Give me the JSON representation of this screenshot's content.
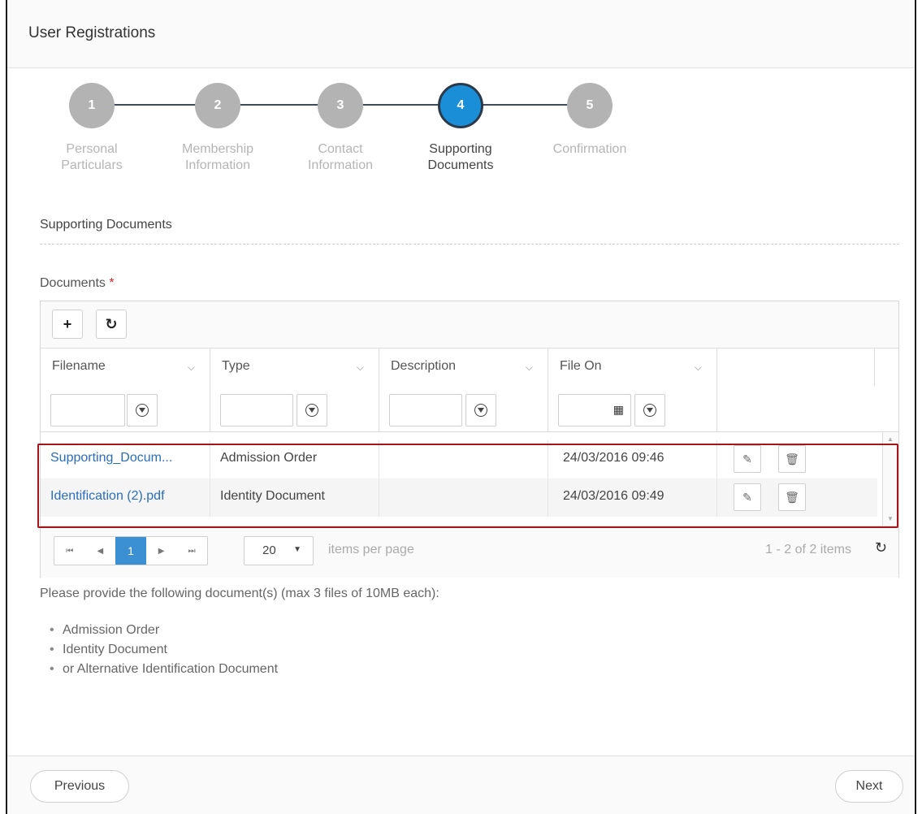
{
  "window": {
    "title": "User Registrations"
  },
  "stepper": {
    "steps": [
      {
        "number": "1",
        "label_line1": "Personal",
        "label_line2": "Particulars"
      },
      {
        "number": "2",
        "label_line1": "Membership",
        "label_line2": "Information"
      },
      {
        "number": "3",
        "label_line1": "Contact",
        "label_line2": "Information"
      },
      {
        "number": "4",
        "label_line1": "Supporting",
        "label_line2": "Documents"
      },
      {
        "number": "5",
        "label_line1": "Confirmation",
        "label_line2": ""
      }
    ],
    "active_step": 4
  },
  "section": {
    "title": "Supporting Documents"
  },
  "documents": {
    "label": "Documents",
    "required_mark": "*",
    "toolbar": {
      "add_icon": "plus-icon",
      "refresh_icon": "refresh-icon"
    },
    "columns": [
      "Filename",
      "Type",
      "Description",
      "File On"
    ],
    "rows": [
      {
        "filename": "Supporting_Docum...",
        "type": "Admission Order",
        "description": "",
        "file_on": "24/03/2016 09:46"
      },
      {
        "filename": "Identification (2).pdf",
        "type": "Identity Document",
        "description": "",
        "file_on": "24/03/2016 09:49"
      }
    ],
    "pager": {
      "current_page": "1",
      "page_size": "20",
      "items_per_page_label": "items per page",
      "count_text": "1 - 2 of 2 items"
    }
  },
  "note": {
    "text": "Please provide the following document(s) (max 3 files of 10MB each):",
    "items": [
      "Admission Order",
      "Identity Document",
      "or Alternative Identification Document"
    ]
  },
  "footer": {
    "previous_label": "Previous",
    "next_label": "Next"
  },
  "colors": {
    "accent": "#1a8fd7",
    "link": "#2a6ebb",
    "highlight": "#a3161b",
    "required": "#d9262c"
  }
}
